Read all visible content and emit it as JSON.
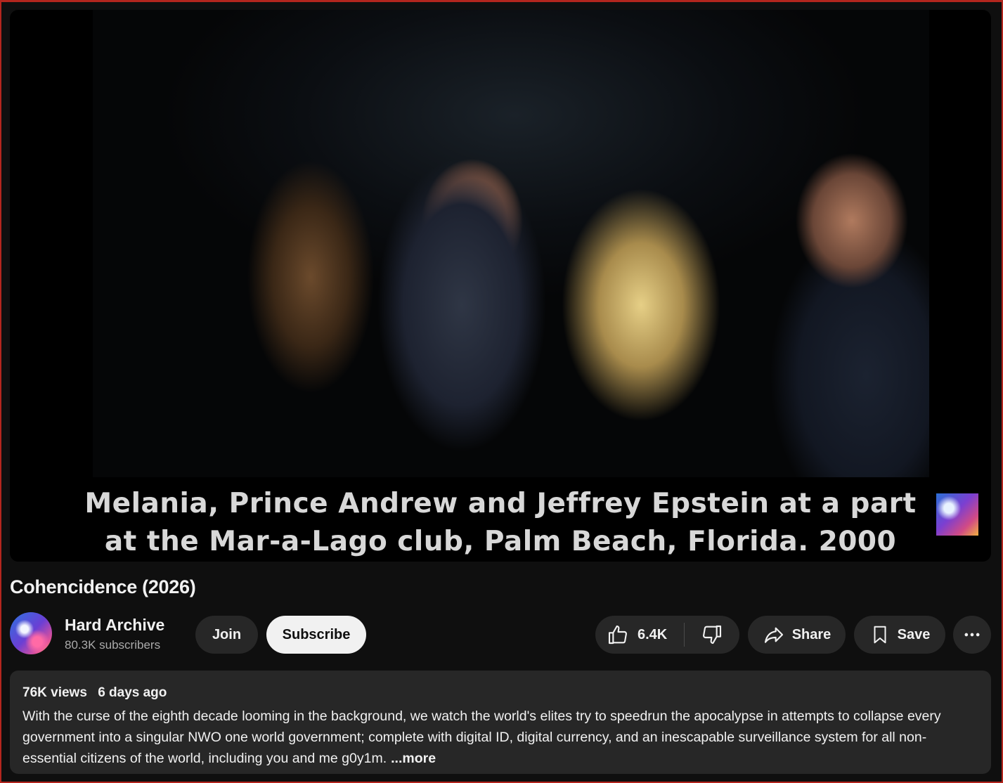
{
  "video": {
    "caption_line1": "Melania, Prince Andrew and Jeffrey Epstein at a part",
    "caption_line2": "at the Mar-a-Lago club, Palm Beach, Florida. 2000"
  },
  "title": "Cohencidence (2026)",
  "channel": {
    "name": "Hard Archive",
    "subscribers": "80.3K subscribers"
  },
  "actions": {
    "join_label": "Join",
    "subscribe_label": "Subscribe",
    "like_count": "6.4K",
    "share_label": "Share",
    "save_label": "Save"
  },
  "description": {
    "views": "76K views",
    "age": "6 days ago",
    "text": "With the curse of the eighth decade looming in the background, we watch the world's elites try to speedrun the apocalypse in attempts to collapse every government into a singular NWO one world government; complete with digital ID, digital currency, and an inescapable surveillance system for all non-essential citizens of the world, including you and me g0y1m.",
    "more_label": "...more"
  },
  "icons": {
    "like": "thumbs-up-icon",
    "dislike": "thumbs-down-icon",
    "share": "share-arrow-icon",
    "save": "bookmark-icon",
    "more": "more-horizontal-icon"
  },
  "colors": {
    "background": "#0f0f0f",
    "button": "#272727",
    "subscribe": "#f1f1f1",
    "frame_border": "#b3261e"
  }
}
